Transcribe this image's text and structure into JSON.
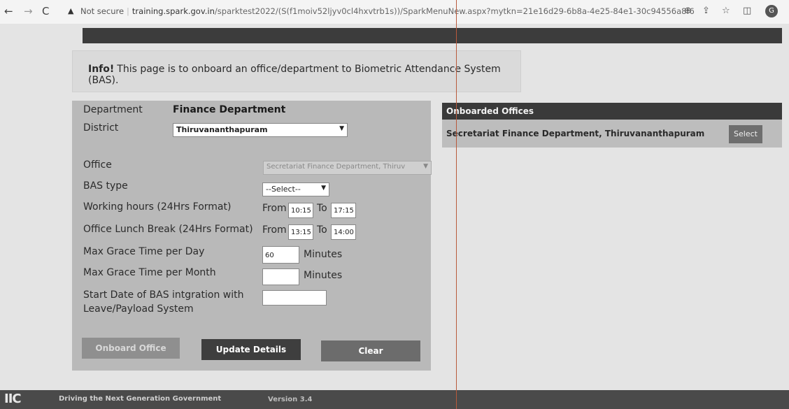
{
  "browser": {
    "security_label": "Not secure",
    "host": "training.spark.gov.in",
    "path": "/sparktest2022/(S(f1moiv52ljyv0cl4hxvtrb1s))/SparkMenuNew.aspx?mytkn=21e16d29-6b8a-4e25-84e1-30c94556a8f6",
    "profile_initial": "G"
  },
  "info": {
    "prefix": "Info!",
    "message": "This page is to onboard an office/department to Biometric Attendance System (BAS)."
  },
  "form": {
    "department_label": "Department",
    "department_value": "Finance Department",
    "district_label": "District",
    "district_value": "Thiruvananthapuram",
    "office_label": "Office",
    "office_value": "Secretariat Finance Department, Thiruv",
    "bas_type_label": "BAS type",
    "bas_type_value": "--Select--",
    "working_hours_label": "Working hours (24Hrs Format)",
    "lunch_break_label": "Office Lunch Break (24Hrs Format)",
    "from_label": "From",
    "to_label": "To",
    "working_from": "10:15",
    "working_to": "17:15",
    "lunch_from": "13:15",
    "lunch_to": "14:00",
    "grace_day_label": "Max Grace Time per Day",
    "grace_day_value": "60",
    "grace_month_label": "Max Grace Time per Month",
    "grace_month_value": "",
    "minutes_label": "Minutes",
    "start_date_label_line1": "Start Date of BAS intgration with",
    "start_date_label_line2": "Leave/Payload System",
    "start_date_value": ""
  },
  "buttons": {
    "onboard": "Onboard Office",
    "update": "Update Details",
    "clear": "Clear"
  },
  "onboarded": {
    "header": "Onboarded Offices",
    "rows": [
      {
        "name": "Secretariat Finance Department, Thiruvananthapuram",
        "action": "Select"
      }
    ]
  },
  "footer": {
    "logo": "IIC",
    "tagline": "Driving the Next Generation Government",
    "version": "Version 3.4"
  }
}
